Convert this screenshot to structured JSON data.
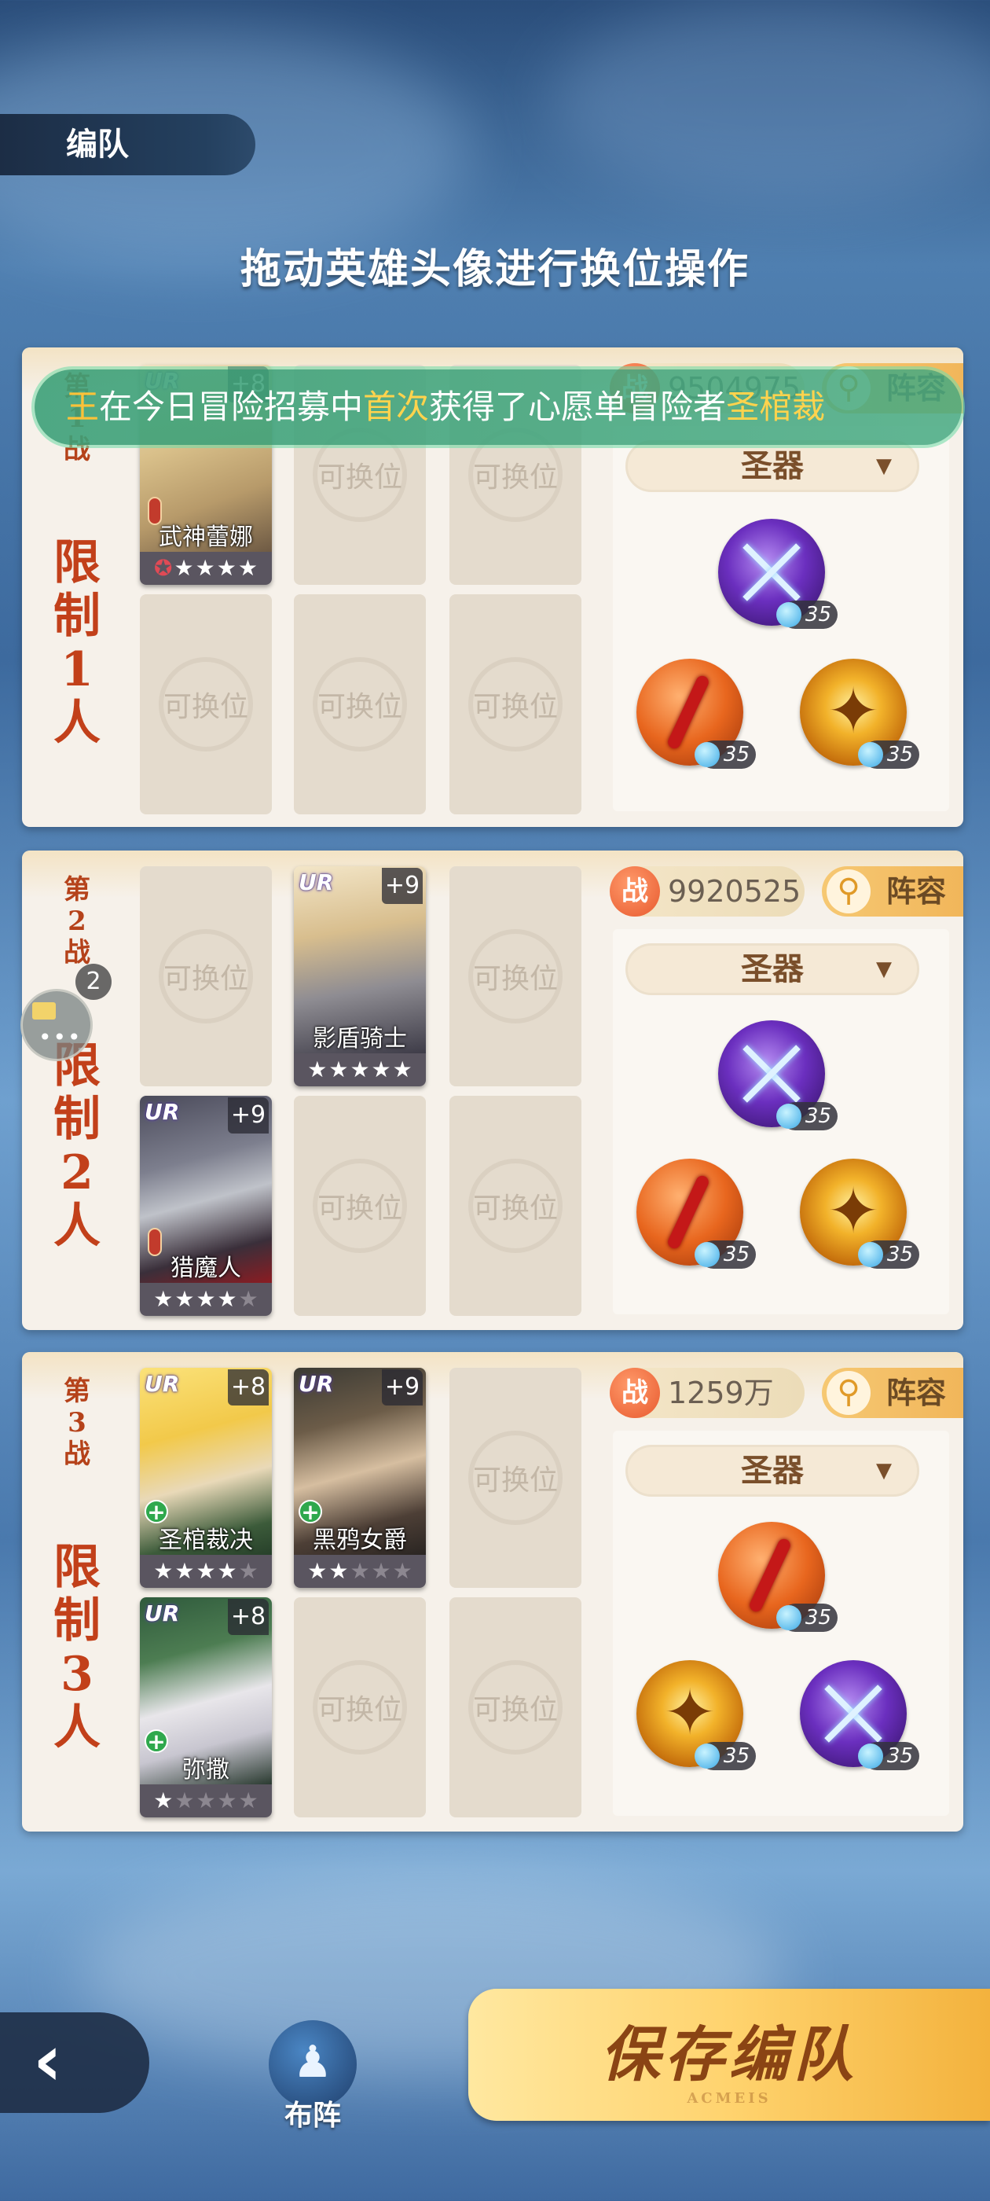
{
  "header": {
    "tab_title": "编队",
    "hint": "拖动英雄头像进行换位操作"
  },
  "common": {
    "empty_slot": "可换位",
    "dropdown": "圣器",
    "lineup_btn": "阵容",
    "power_icon": "战"
  },
  "marquee": {
    "p1": "王",
    "p2": "在今日冒险招募中",
    "p3": "首次",
    "p4": "获得了心愿单冒险者",
    "p5": "圣棺裁"
  },
  "battles": [
    {
      "battle_label": [
        "第",
        "1",
        "战"
      ],
      "limit": [
        "限",
        "制",
        "1",
        "人"
      ],
      "power": "9504975",
      "heroes": [
        {
          "name": "武神蕾娜",
          "rarity": "UR",
          "level": "+8",
          "stars": 5
        }
      ],
      "artifact_level": "35"
    },
    {
      "battle_label": [
        "第",
        "2",
        "战"
      ],
      "limit": [
        "限",
        "制",
        "2",
        "人"
      ],
      "power": "9920525",
      "heroes": [
        {
          "name": "影盾骑士",
          "rarity": "UR",
          "level": "+9",
          "stars": 5
        },
        {
          "name": "猎魔人",
          "rarity": "UR",
          "level": "+9",
          "stars": 4
        }
      ],
      "artifact_level": "35"
    },
    {
      "battle_label": [
        "第",
        "3",
        "战"
      ],
      "limit": [
        "限",
        "制",
        "3",
        "人"
      ],
      "power": "1259万",
      "heroes": [
        {
          "name": "圣棺裁决",
          "rarity": "UR",
          "level": "+8",
          "stars": 4
        },
        {
          "name": "黑鸦女爵",
          "rarity": "UR",
          "level": "+9",
          "stars": 2
        },
        {
          "name": "弥撒",
          "rarity": "UR",
          "level": "+8",
          "stars": 1
        }
      ],
      "artifact_level": "35"
    }
  ],
  "chat": {
    "count": "2"
  },
  "footer": {
    "formation_label": "布阵",
    "save_label": "保存编队",
    "save_sub": "ACMEIS"
  }
}
